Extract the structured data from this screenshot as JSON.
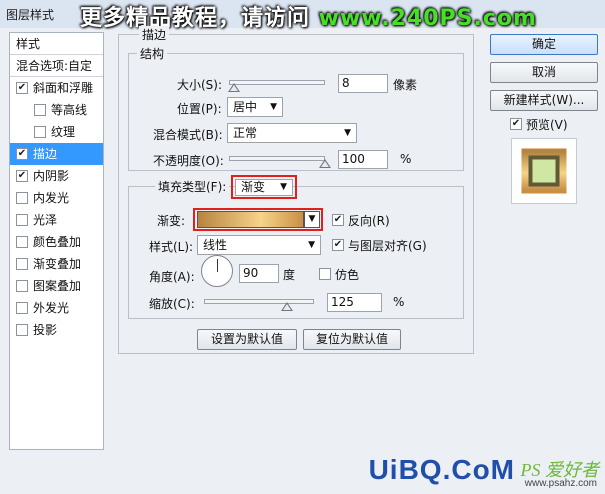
{
  "window": {
    "title": "图层样式"
  },
  "banner": {
    "prefix": "更多精品教程，请访问 ",
    "site": "www.240PS.com"
  },
  "left_panel": {
    "header_items": [
      "样式",
      "混合选项:自定"
    ],
    "items": [
      {
        "label": "斜面和浮雕",
        "checked": true,
        "indent": false,
        "selected": false
      },
      {
        "label": "等高线",
        "checked": false,
        "indent": true,
        "selected": false
      },
      {
        "label": "纹理",
        "checked": false,
        "indent": true,
        "selected": false
      },
      {
        "label": "描边",
        "checked": true,
        "indent": false,
        "selected": true
      },
      {
        "label": "内阴影",
        "checked": true,
        "indent": false,
        "selected": false
      },
      {
        "label": "内发光",
        "checked": false,
        "indent": false,
        "selected": false
      },
      {
        "label": "光泽",
        "checked": false,
        "indent": false,
        "selected": false
      },
      {
        "label": "颜色叠加",
        "checked": false,
        "indent": false,
        "selected": false
      },
      {
        "label": "渐变叠加",
        "checked": false,
        "indent": false,
        "selected": false
      },
      {
        "label": "图案叠加",
        "checked": false,
        "indent": false,
        "selected": false
      },
      {
        "label": "外发光",
        "checked": false,
        "indent": false,
        "selected": false
      },
      {
        "label": "投影",
        "checked": false,
        "indent": false,
        "selected": false
      }
    ]
  },
  "stroke": {
    "title": "描边",
    "structure": {
      "title": "结构",
      "size_label": "大小(S):",
      "size_value": "8",
      "size_unit": "像素",
      "size_slider": 0.05,
      "position_label": "位置(P):",
      "position_value": "居中",
      "blend_label": "混合模式(B):",
      "blend_value": "正常",
      "opacity_label": "不透明度(O):",
      "opacity_value": "100",
      "opacity_unit": "%",
      "opacity_slider": 1.0
    },
    "fill": {
      "type_label": "填充类型(F):",
      "type_value": "渐变",
      "gradient_label": "渐变:",
      "reverse_label": "反向(R)",
      "reverse_checked": true,
      "style_label": "样式(L):",
      "style_value": "线性",
      "align_label": "与图层对齐(G)",
      "align_checked": true,
      "angle_label": "角度(A):",
      "angle_value": "90",
      "angle_unit": "度",
      "dither_label": "仿色",
      "dither_checked": false,
      "scale_label": "缩放(C):",
      "scale_value": "125",
      "scale_unit": "%",
      "scale_slider": 0.75
    },
    "set_default_label": "设置为默认值",
    "reset_default_label": "复位为默认值"
  },
  "right_panel": {
    "ok_label": "确定",
    "cancel_label": "取消",
    "new_style_label": "新建样式(W)...",
    "preview_label": "预览(V)",
    "preview_checked": true
  },
  "watermark": {
    "logo": "UiBQ.CoM",
    "script": "PS 爱好者",
    "url": "www.psahz.com"
  },
  "colors": {
    "selection": "#3399ff",
    "highlight_border": "#e0201b",
    "gradient_stops": [
      "#b8843f",
      "#f6d489",
      "#c98f45"
    ],
    "banner_green": "#47e027"
  }
}
